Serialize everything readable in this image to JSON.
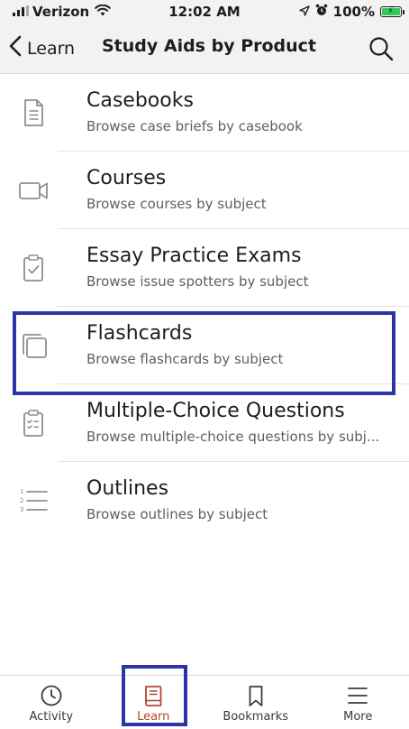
{
  "status_bar": {
    "carrier": "Verizon",
    "time": "12:02 AM",
    "battery_percent": "100%",
    "icons": [
      "signal-icon",
      "wifi-icon",
      "location-arrow-icon",
      "alarm-icon",
      "battery-charging-icon"
    ]
  },
  "nav": {
    "back_label": "Learn",
    "title": "Study Aids by Product",
    "search_icon": "search-icon"
  },
  "list": {
    "items": [
      {
        "title": "Casebooks",
        "subtitle": "Browse case briefs by casebook",
        "icon": "document-icon"
      },
      {
        "title": "Courses",
        "subtitle": "Browse courses by subject",
        "icon": "video-camera-icon"
      },
      {
        "title": "Essay Practice Exams",
        "subtitle": "Browse issue spotters by subject",
        "icon": "clipboard-check-icon"
      },
      {
        "title": "Flashcards",
        "subtitle": "Browse flashcards by subject",
        "icon": "flashcards-icon"
      },
      {
        "title": "Multiple-Choice Questions",
        "subtitle": "Browse multiple-choice questions by subj...",
        "icon": "clipboard-list-icon"
      },
      {
        "title": "Outlines",
        "subtitle": "Browse outlines by subject",
        "icon": "numbered-list-icon"
      }
    ]
  },
  "tab_bar": {
    "tabs": [
      {
        "label": "Activity",
        "icon": "clock-icon",
        "active": false
      },
      {
        "label": "Learn",
        "icon": "book-icon",
        "active": true
      },
      {
        "label": "Bookmarks",
        "icon": "bookmark-icon",
        "active": false
      },
      {
        "label": "More",
        "icon": "menu-icon",
        "active": false
      }
    ]
  },
  "colors": {
    "accent": "#b3472b",
    "highlight_border": "#2b35a6",
    "icon_gray": "#8e8e93",
    "battery_green": "#34c759"
  }
}
